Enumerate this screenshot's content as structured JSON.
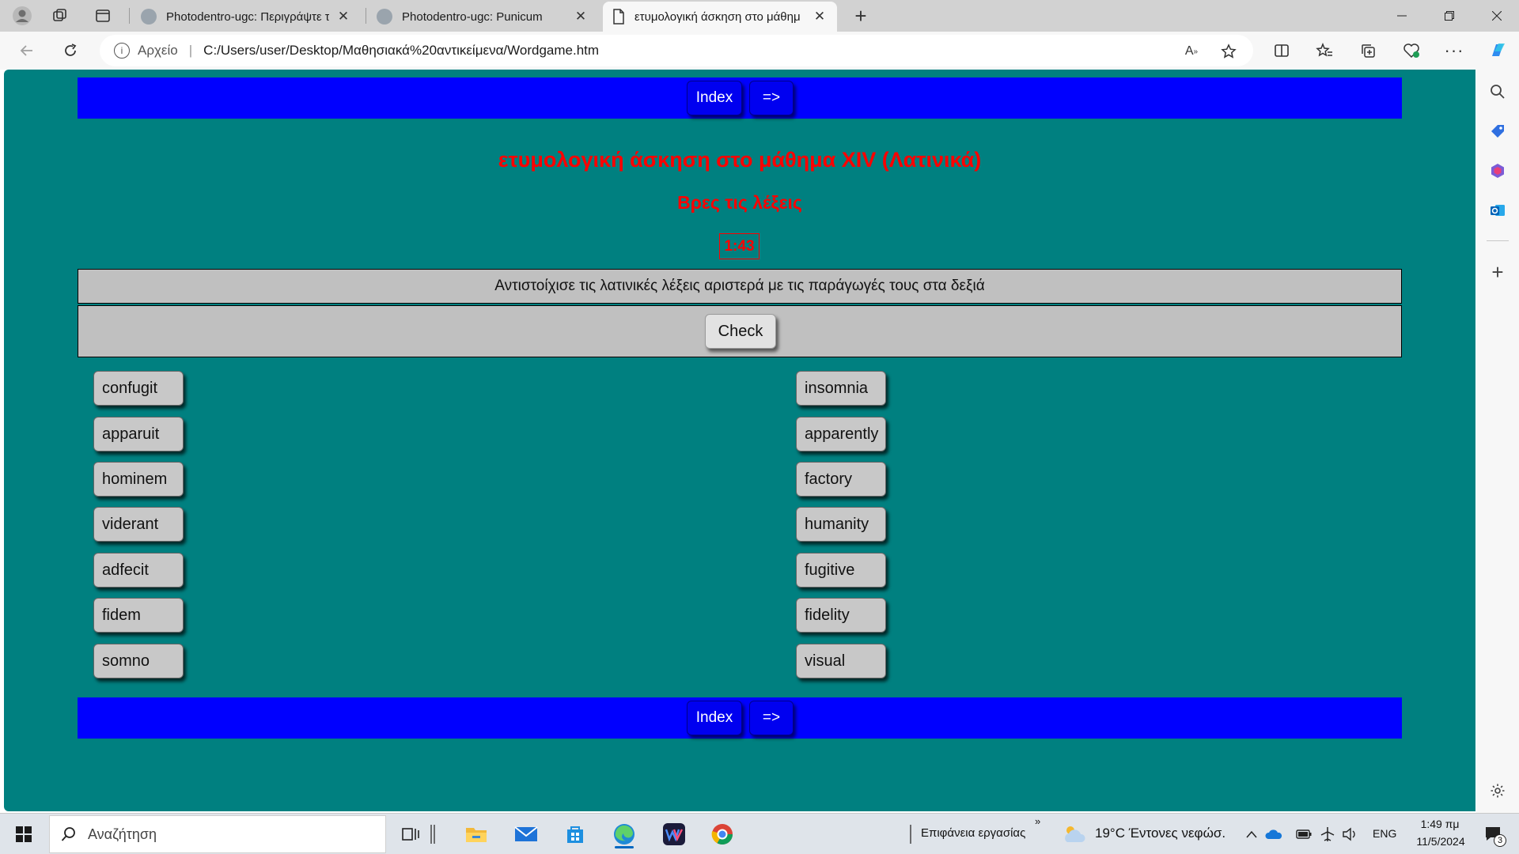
{
  "browser": {
    "tabs": [
      {
        "label": "Photodentro-ugc: Περιγράψτε τ",
        "active": false
      },
      {
        "label": "Photodentro-ugc: Punicum",
        "active": false
      },
      {
        "label": "ετυμολογική άσκηση στο μάθημ",
        "active": true
      }
    ],
    "address": {
      "security_label": "Αρχείο",
      "url": "C:/Users/user/Desktop/Μαθησιακά%20αντικείμενα/Wordgame.htm"
    }
  },
  "page": {
    "nav": {
      "index_label": "Index",
      "next_label": "=>"
    },
    "heading": "ετυμολογική άσκηση στο μάθημα XIV (Λατινικά)",
    "subheading": "Βρες τις λέξεις",
    "timer": "1:43",
    "instructions": "Αντιστοίχισε τις λατινικές λέξεις αριστερά με τις παράγωγές τους στα δεξιά",
    "check_label": "Check",
    "left_words": [
      "confugit",
      "apparuit",
      "hominem",
      "viderant",
      "adfecit",
      "fidem",
      "somno"
    ],
    "right_words": [
      "insomnia",
      "apparently",
      "factory",
      "humanity",
      "fugitive",
      "fidelity",
      "visual"
    ]
  },
  "taskbar": {
    "search_placeholder": "Αναζήτηση",
    "desktop_label": "Επιφάνεια εργασίας",
    "weather": "19°C  Έντονες νεφώσ.",
    "language": "ENG",
    "time": "1:49 πμ",
    "date": "11/5/2024",
    "notification_count": "3"
  },
  "colors": {
    "page_background": "#008080",
    "nav_bar": "#0000ff",
    "heading": "#ff0000",
    "panel": "#c0c0c0"
  }
}
